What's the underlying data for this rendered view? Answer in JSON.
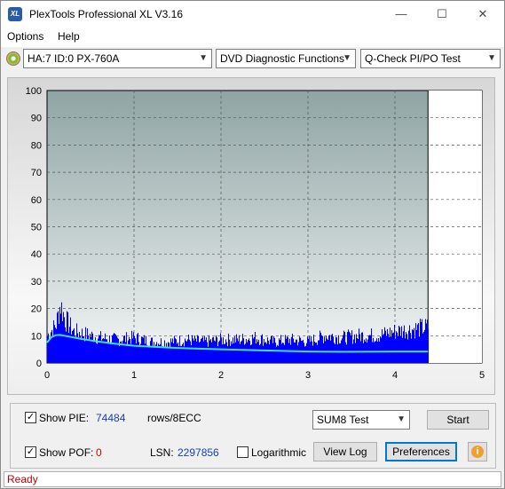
{
  "window": {
    "title": "PlexTools Professional XL V3.16",
    "logo_text": "XL"
  },
  "menu": {
    "items": [
      "Options",
      "Help"
    ]
  },
  "toolbar": {
    "drive": "HA:7 ID:0  PX-760A",
    "function": "DVD Diagnostic Functions",
    "test": "Q-Check PI/PO Test"
  },
  "chart_data": {
    "type": "area",
    "xlim": [
      0,
      5
    ],
    "ylim": [
      0,
      100
    ],
    "x_ticks": [
      "0",
      "1",
      "2",
      "3",
      "4",
      "5"
    ],
    "y_ticks": [
      "0",
      "10",
      "20",
      "30",
      "40",
      "50",
      "60",
      "70",
      "80",
      "90",
      "100"
    ],
    "grid": true,
    "data_end_x": 4.38,
    "series": [
      {
        "kind": "bars",
        "color": "#0000ff",
        "x": [
          0.0,
          0.1,
          0.15,
          0.2,
          0.3,
          0.4,
          0.5,
          0.6,
          0.8,
          1.0,
          1.2,
          1.4,
          1.6,
          1.8,
          2.0,
          2.2,
          2.4,
          2.6,
          2.8,
          3.0,
          3.2,
          3.4,
          3.6,
          3.8,
          4.0,
          4.2,
          4.38
        ],
        "values": [
          13,
          18,
          28,
          21,
          15,
          14,
          13,
          12,
          11,
          12,
          10,
          10,
          11,
          10,
          11,
          11,
          12,
          10,
          11,
          10,
          13,
          12,
          13,
          13,
          15,
          16,
          17
        ]
      },
      {
        "kind": "line",
        "color": "#40e0e0",
        "x": [
          0.0,
          0.05,
          0.1,
          0.15,
          0.2,
          0.4,
          0.6,
          0.8,
          1.0,
          1.5,
          2.0,
          2.5,
          3.0,
          3.5,
          4.0,
          4.38
        ],
        "values": [
          7.5,
          9.5,
          10.2,
          10.3,
          10,
          8.8,
          7.8,
          7.0,
          6.3,
          5.5,
          5.0,
          4.6,
          4.2,
          4.1,
          4.2,
          4.2
        ]
      }
    ],
    "colors": {
      "plot_bg_top": "#8fa4a4",
      "plot_bg_bottom": "#f4f6f6",
      "bars": "#0000ff",
      "line": "#40e0e0"
    }
  },
  "controls": {
    "show_pie_label": "Show PIE:",
    "pie_value": "74484",
    "pie_unit": "rows/8ECC",
    "show_pof_label": "Show POF:",
    "pof_value": "0",
    "lsn_label": "LSN:",
    "lsn_value": "2297856",
    "logarithmic_label": "Logarithmic",
    "sum_test": "SUM8 Test",
    "start": "Start",
    "view_log": "View Log",
    "preferences": "Preferences",
    "show_pie_checked": true,
    "show_pof_checked": true,
    "logarithmic_checked": false
  },
  "status": {
    "text": "Ready"
  }
}
